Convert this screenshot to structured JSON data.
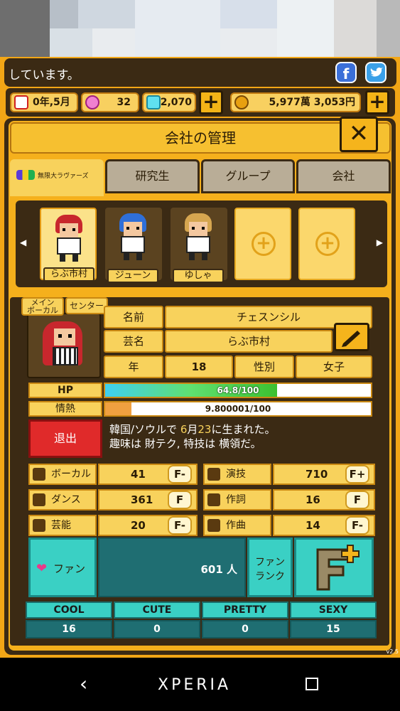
{
  "ticker": {
    "text": "しています。"
  },
  "status": {
    "date": "0年,5月",
    "gems": "32",
    "diamonds": "2,070",
    "money": "5,977萬 3,053円"
  },
  "dialog": {
    "title": "会社の管理",
    "close": "✕"
  },
  "tabs": [
    {
      "label": "無限大ラヴァーズ",
      "active": true
    },
    {
      "label": "研究生"
    },
    {
      "label": "グループ"
    },
    {
      "label": "会社"
    }
  ],
  "roster": [
    {
      "name": "らぶ市村",
      "selected": true,
      "hair": "#c8272d",
      "hair_dark": "#8a1418"
    },
    {
      "name": "ジューン",
      "selected": false,
      "hair": "#2f6fd8",
      "hair_dark": "#1a3f8a"
    },
    {
      "name": "ゆしゃ",
      "selected": false,
      "hair": "#d6a650",
      "hair_dark": "#9a6e26"
    }
  ],
  "profile": {
    "role_badges": [
      "メイン\nボーカル",
      "センター"
    ],
    "name_label": "名前",
    "name_value": "チェスンシル",
    "stage_label": "芸名",
    "stage_value": "らぶ市村",
    "age_label": "年",
    "age_value": "18",
    "gender_label": "性別",
    "gender_value": "女子"
  },
  "bars": {
    "hp": {
      "label": "HP",
      "text": "64.8/100",
      "fraction": 0.648
    },
    "passion": {
      "label": "情熱",
      "text": "9.800001/100",
      "fraction": 0.098
    }
  },
  "retire": {
    "label": "退出"
  },
  "bio": {
    "line1_a": "韓国/ソウルで ",
    "line1_b": "6",
    "line1_c": "月",
    "line1_d": "23",
    "line1_e": "に生まれた。",
    "line2": "趣味は 財テク, 特技は 横領だ。"
  },
  "skills": [
    {
      "label": "ボーカル",
      "value": "41",
      "grade": "F-",
      "icon": "microphone-icon"
    },
    {
      "label": "ダンス",
      "value": "361",
      "grade": "F",
      "icon": "dance-shoe-icon"
    },
    {
      "label": "芸能",
      "value": "20",
      "grade": "F-",
      "icon": "mask-icon"
    },
    {
      "label": "演技",
      "value": "710",
      "grade": "F+",
      "icon": "camera-icon"
    },
    {
      "label": "作詞",
      "value": "16",
      "grade": "F",
      "icon": "pen-icon"
    },
    {
      "label": "作曲",
      "value": "14",
      "grade": "F-",
      "icon": "keyboard-icon"
    }
  ],
  "fans": {
    "label": "ファン",
    "count": "601 人",
    "rank_label": "ファン\nランク",
    "rank_grade": "F+"
  },
  "types": [
    {
      "label": "COOL",
      "value": "16"
    },
    {
      "label": "CUTE",
      "value": "0"
    },
    {
      "label": "PRETTY",
      "value": "0"
    },
    {
      "label": "SEXY",
      "value": "15"
    }
  ],
  "version": "v2.5",
  "navbar": {
    "brand": "XPERIA"
  },
  "colors": {
    "accent": "#f5b01c",
    "panel": "#3b2a14",
    "teal": "#3ad0c4",
    "retire": "#e02a2a"
  }
}
